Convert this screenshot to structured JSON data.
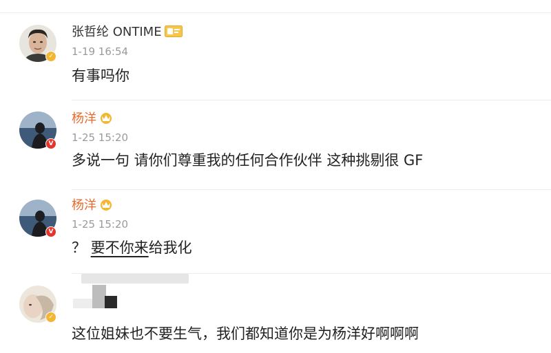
{
  "colors": {
    "author_default": "#333333",
    "author_highlight": "#e86a2c",
    "timestamp": "#9a9a9a",
    "content": "#222222",
    "badge_yellow": "#f2b632",
    "badge_red": "#e5352c",
    "divider": "#ececec"
  },
  "comments": [
    {
      "author": "张哲纶 ONTIME",
      "author_badge": "member-card-icon",
      "avatar_badge": "yellow-verified-badge",
      "time": "1-19 16:54",
      "text": "有事吗你"
    },
    {
      "author": "杨洋",
      "author_badge": "crown-fan-icon",
      "avatar_badge": "red-v-badge",
      "time": "1-25 15:20",
      "text": "多说一句 请你们尊重我的任何合作伙伴 这种挑剔很 GF"
    },
    {
      "author": "杨洋",
      "author_badge": "crown-fan-icon",
      "avatar_badge": "red-v-badge",
      "time": "1-25 15:20",
      "text_prefix": "？ ",
      "text_underlined": "要不你来",
      "text_suffix": "给我化"
    },
    {
      "author": "",
      "author_badge": "",
      "avatar_badge": "yellow-verified-badge",
      "time": "",
      "text": "这位姐妹也不要生气，我们都知道你是为杨洋好啊啊啊",
      "author_redacted": true
    }
  ]
}
